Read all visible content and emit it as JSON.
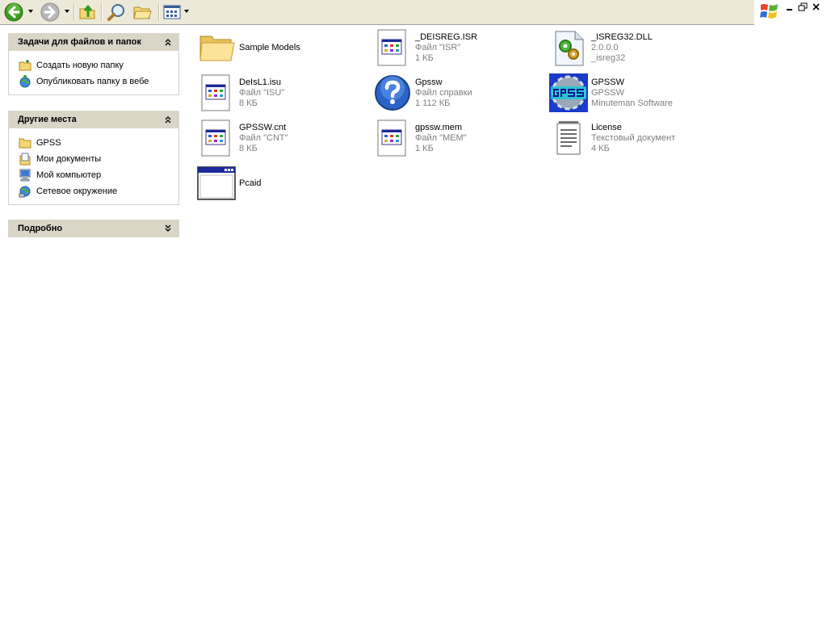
{
  "toolbar": {
    "icons": [
      "back-icon",
      "forward-icon",
      "up-folder-icon",
      "search-icon",
      "folders-icon",
      "views-icon"
    ]
  },
  "task_panels": [
    {
      "title": "Задачи для файлов и папок",
      "items": [
        {
          "label": "Создать новую папку",
          "icon": "new-folder-icon"
        },
        {
          "label": "Опубликовать папку в вебе",
          "icon": "publish-web-icon"
        }
      ]
    },
    {
      "title": "Другие места",
      "items": [
        {
          "label": "GPSS",
          "icon": "folder-icon"
        },
        {
          "label": "Мои документы",
          "icon": "my-documents-icon"
        },
        {
          "label": "Мой компьютер",
          "icon": "my-computer-icon"
        },
        {
          "label": "Сетевое окружение",
          "icon": "network-icon"
        }
      ]
    },
    {
      "title": "Подробно",
      "items": []
    }
  ],
  "files": [
    {
      "name": "Sample Models",
      "line2": "",
      "line3": "",
      "icon": "folder-icon"
    },
    {
      "name": "_DEISREG.ISR",
      "line2": "Файл \"ISR\"",
      "line3": "1 КБ",
      "icon": "generic-file-icon"
    },
    {
      "name": "_ISREG32.DLL",
      "line2": "2.0.0.0",
      "line3": "_isreg32",
      "icon": "dll-icon"
    },
    {
      "name": "DeIsL1.isu",
      "line2": "Файл \"ISU\"",
      "line3": "8 КБ",
      "icon": "generic-file-icon"
    },
    {
      "name": "Gpssw",
      "line2": "Файл справки",
      "line3": "1 112 КБ",
      "icon": "help-icon"
    },
    {
      "name": "GPSSW",
      "line2": "GPSSW",
      "line3": "Minuteman Software",
      "icon": "gpss-app-icon"
    },
    {
      "name": "GPSSW.cnt",
      "line2": "Файл \"CNT\"",
      "line3": "8 КБ",
      "icon": "generic-file-icon"
    },
    {
      "name": "gpssw.mem",
      "line2": "Файл \"MEM\"",
      "line3": "1 КБ",
      "icon": "generic-file-icon"
    },
    {
      "name": "License",
      "line2": "Текстовый документ",
      "line3": "4 КБ",
      "icon": "text-document-icon"
    },
    {
      "name": "Pcaid",
      "line2": "",
      "line3": "",
      "icon": "application-window-icon"
    }
  ],
  "colors": {
    "toolbar_bg": "#ece9d8",
    "panel_header_bg": "#d9d6c8",
    "secondary_text": "#7f7f7f",
    "back_green": "#3b9a1f"
  }
}
